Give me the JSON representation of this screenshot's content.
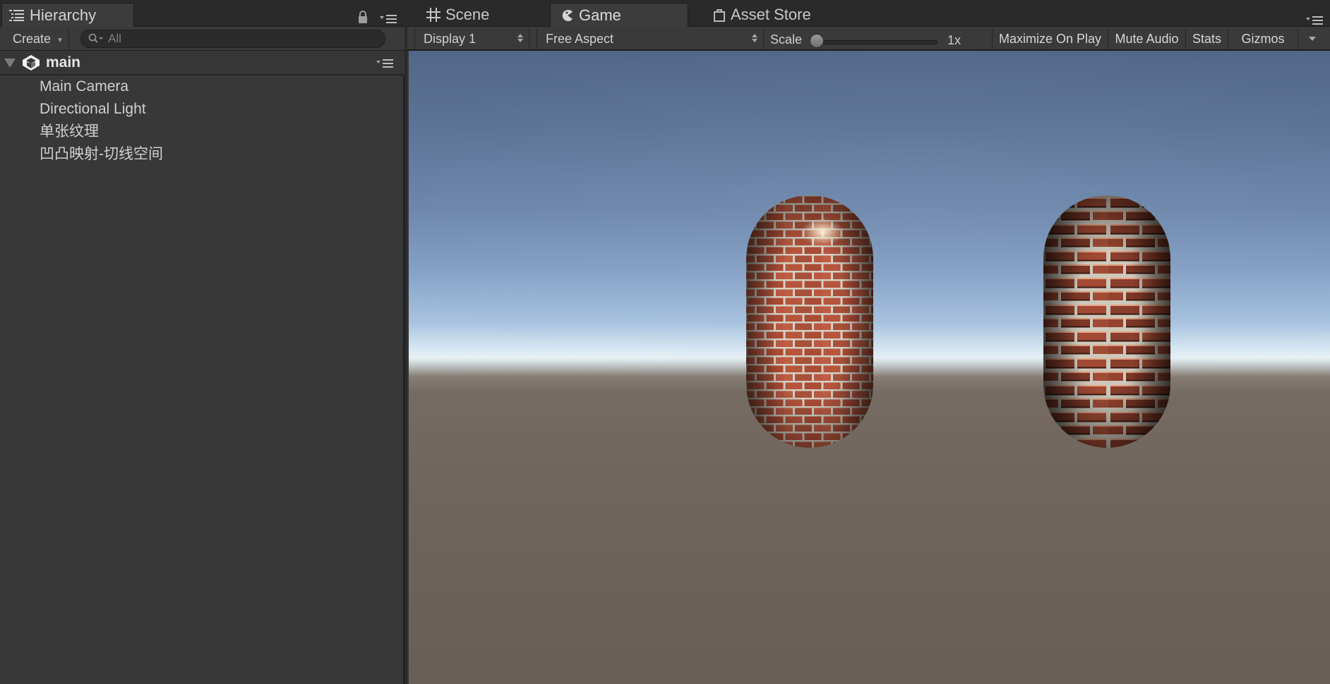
{
  "hierarchy": {
    "tab_label": "Hierarchy",
    "create_label": "Create",
    "search_placeholder": "All",
    "scene_name": "main",
    "items": [
      {
        "label": "Main Camera"
      },
      {
        "label": "Directional Light"
      },
      {
        "label": "单张纹理"
      },
      {
        "label": "凹凸映射-切线空间"
      }
    ]
  },
  "game_window": {
    "tabs": [
      {
        "label": "Scene",
        "icon": "grid-icon"
      },
      {
        "label": "Game",
        "icon": "pacman-icon",
        "active": true
      },
      {
        "label": "Asset Store",
        "icon": "bag-icon"
      }
    ],
    "toolbar": {
      "display": "Display 1",
      "aspect": "Free Aspect",
      "scale_label": "Scale",
      "scale_value": "1x",
      "maximize_on_play": "Maximize On Play",
      "mute_audio": "Mute Audio",
      "stats": "Stats",
      "gizmos": "Gizmos"
    }
  },
  "colors": {
    "panel_bg": "#383838",
    "tab_bg": "#2a2a2a",
    "sky_top": "#516787",
    "horizon": "#e7f2f5",
    "ground": "#6f655d",
    "brick": "#b5543a",
    "mortar": "#d8d2c6"
  }
}
